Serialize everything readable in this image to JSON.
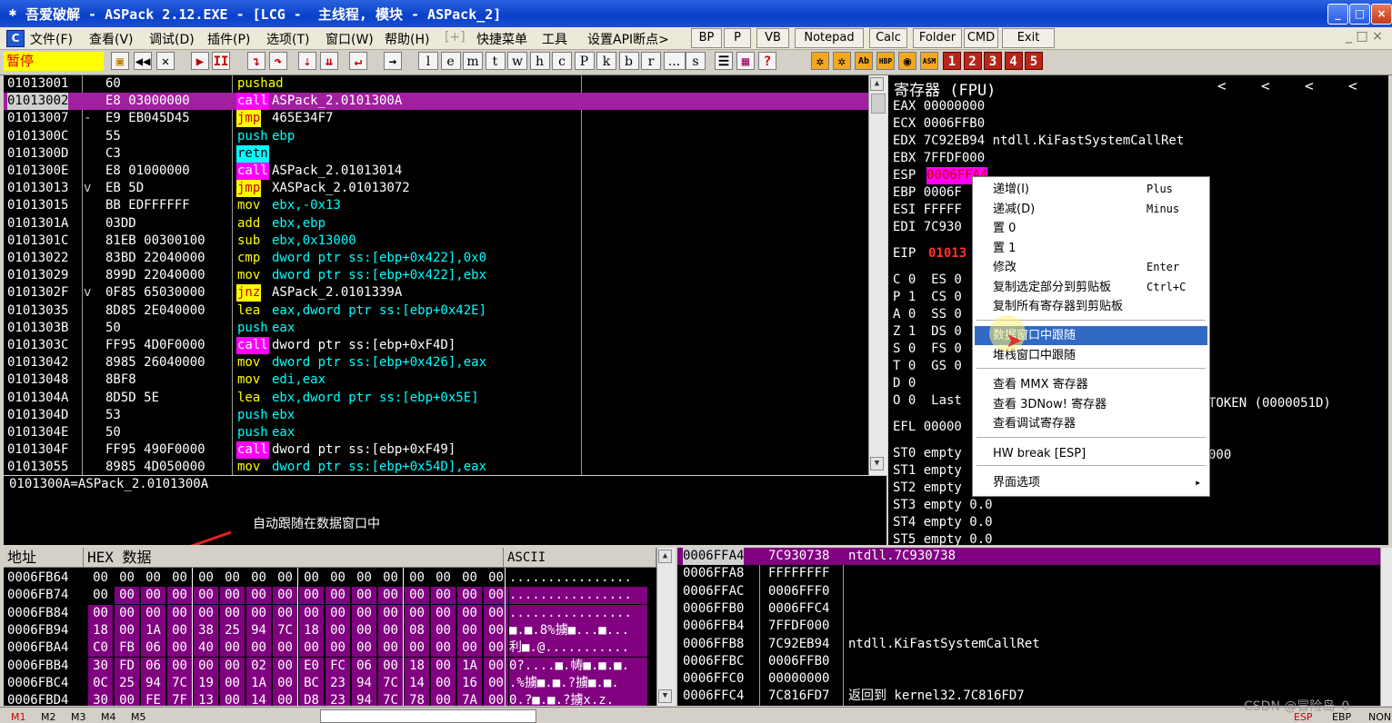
{
  "window": {
    "title": "吾爱破解 - ASPack 2.12.EXE - [LCG -  主线程, 模块 - ASPack_2]",
    "min": "_",
    "max": "□",
    "close": "×"
  },
  "menu": {
    "items": [
      "文件(F)",
      "查看(V)",
      "调试(D)",
      "插件(P)",
      "选项(T)",
      "窗口(W)",
      "帮助(H)",
      "[+]",
      "快捷菜单",
      "工具",
      "设置API断点>"
    ],
    "buttons": [
      "BP",
      "P",
      "VB",
      "Notepad",
      "Calc",
      "Folder",
      "CMD",
      "Exit"
    ]
  },
  "toolbar": {
    "status": "暂停",
    "letters": [
      "l",
      "e",
      "m",
      "t",
      "w",
      "h",
      "c",
      "P",
      "k",
      "b",
      "r",
      "...",
      "s"
    ],
    "nums": [
      "1",
      "2",
      "3",
      "4",
      "5"
    ]
  },
  "disasm": {
    "rows": [
      {
        "addr": "01013001",
        "mark": "",
        "hex": "60",
        "op": "pushad",
        "args": ""
      },
      {
        "addr": "01013002",
        "mark": "",
        "hex": "E8 03000000",
        "op": "call",
        "args": "ASPack_2.0101300A"
      },
      {
        "addr": "01013007",
        "mark": "-",
        "hex": "E9 EB045D45",
        "op": "jmp",
        "args": "465E34F7"
      },
      {
        "addr": "0101300C",
        "mark": "",
        "hex": "55",
        "op": "push",
        "args": "ebp"
      },
      {
        "addr": "0101300D",
        "mark": "",
        "hex": "C3",
        "op": "retn",
        "args": ""
      },
      {
        "addr": "0101300E",
        "mark": "",
        "hex": "E8 01000000",
        "op": "call",
        "args": "ASPack_2.01013014"
      },
      {
        "addr": "01013013",
        "mark": "v",
        "hex": "EB 5D",
        "op": "jmp",
        "args": "XASPack_2.01013072"
      },
      {
        "addr": "01013015",
        "mark": "",
        "hex": "BB EDFFFFFF",
        "op": "mov",
        "args": "ebx,-0x13"
      },
      {
        "addr": "0101301A",
        "mark": "",
        "hex": "03DD",
        "op": "add",
        "args": "ebx,ebp"
      },
      {
        "addr": "0101301C",
        "mark": "",
        "hex": "81EB 00300100",
        "op": "sub",
        "args": "ebx,0x13000"
      },
      {
        "addr": "01013022",
        "mark": "",
        "hex": "83BD 22040000",
        "op": "cmp",
        "args": "dword ptr ss:[ebp+0x422],0x0"
      },
      {
        "addr": "01013029",
        "mark": "",
        "hex": "899D 22040000",
        "op": "mov",
        "args": "dword ptr ss:[ebp+0x422],ebx"
      },
      {
        "addr": "0101302F",
        "mark": "v",
        "hex": "0F85 65030000",
        "op": "jnz",
        "args": "ASPack_2.0101339A"
      },
      {
        "addr": "01013035",
        "mark": "",
        "hex": "8D85 2E040000",
        "op": "lea",
        "args": "eax,dword ptr ss:[ebp+0x42E]"
      },
      {
        "addr": "0101303B",
        "mark": "",
        "hex": "50",
        "op": "push",
        "args": "eax"
      },
      {
        "addr": "0101303C",
        "mark": "",
        "hex": "FF95 4D0F0000",
        "op": "call",
        "args": "dword ptr ss:[ebp+0xF4D]"
      },
      {
        "addr": "01013042",
        "mark": "",
        "hex": "8985 26040000",
        "op": "mov",
        "args": "dword ptr ss:[ebp+0x426],eax"
      },
      {
        "addr": "01013048",
        "mark": "",
        "hex": "8BF8",
        "op": "mov",
        "args": "edi,eax"
      },
      {
        "addr": "0101304A",
        "mark": "",
        "hex": "8D5D 5E",
        "op": "lea",
        "args": "ebx,dword ptr ss:[ebp+0x5E]"
      },
      {
        "addr": "0101304D",
        "mark": "",
        "hex": "53",
        "op": "push",
        "args": "ebx"
      },
      {
        "addr": "0101304E",
        "mark": "",
        "hex": "50",
        "op": "push",
        "args": "eax"
      },
      {
        "addr": "0101304F",
        "mark": "",
        "hex": "FF95 490F0000",
        "op": "call",
        "args": "dword ptr ss:[ebp+0xF49]"
      },
      {
        "addr": "01013055",
        "mark": "",
        "hex": "8985 4D050000",
        "op": "mov",
        "args": "dword ptr ss:[ebp+0x54D],eax"
      }
    ],
    "info": "0101300A=ASPack_2.0101300A",
    "annotation": "自动跟随在数据窗口中"
  },
  "registers": {
    "title": "寄存器 (FPU)",
    "nav": [
      "<",
      "<",
      "<",
      "<"
    ],
    "lines": [
      {
        "t": "EAX 00000000",
        "c": "#fff"
      },
      {
        "t": "ECX 0006FFB0",
        "c": "#fff"
      },
      {
        "t": "EDX 7C92EB94 ntdll.KiFastSystemCallRet",
        "c": "#fff"
      },
      {
        "t": "EBX 7FFDF000",
        "c": "#fff"
      },
      {
        "t": "ESP",
        "c": "#fff"
      },
      {
        "t": "EBP 0006F",
        "c": "#fff"
      },
      {
        "t": "ESI FFFFF",
        "c": "#fff"
      },
      {
        "t": "EDI 7C930",
        "c": "#fff"
      },
      {
        "t": "",
        "c": "#fff"
      },
      {
        "t": "EIP",
        "c": "#fff"
      },
      {
        "t": "",
        "c": "#fff"
      },
      {
        "t": "C 0  ES 0",
        "c": "#fff"
      },
      {
        "t": "P 1  CS 0",
        "c": "#fff"
      },
      {
        "t": "A 0  SS 0",
        "c": "#fff"
      },
      {
        "t": "Z 1  DS 0",
        "c": "#fff"
      },
      {
        "t": "S 0  FS 0",
        "c": "#fff"
      },
      {
        "t": "T 0  GS 0",
        "c": "#fff"
      },
      {
        "t": "D 0",
        "c": "#fff"
      },
      {
        "t": "O 0  Last",
        "c": "#fff"
      },
      {
        "t": "",
        "c": "#fff"
      },
      {
        "t": "EFL 00000",
        "c": "#fff"
      },
      {
        "t": "",
        "c": "#fff"
      },
      {
        "t": "ST0 empty",
        "c": "#fff"
      },
      {
        "t": "ST1 empty",
        "c": "#fff"
      },
      {
        "t": "ST2 empty",
        "c": "#fff"
      },
      {
        "t": "ST3 empty 0.0",
        "c": "#fff"
      },
      {
        "t": "ST4 empty 0.0",
        "c": "#fff"
      },
      {
        "t": "ST5 empty 0.0",
        "c": "#fff"
      }
    ],
    "esp_val": "0006FFA4",
    "eip_val": "01013",
    "token": "TOKEN (0000051D)",
    "st1_tail": "000"
  },
  "context_menu": {
    "items": [
      {
        "label": "递增(I)",
        "key": "Plus"
      },
      {
        "label": "递减(D)",
        "key": "Minus"
      },
      {
        "label": "置 0",
        "key": ""
      },
      {
        "label": "置 1",
        "key": ""
      },
      {
        "label": "修改",
        "key": "Enter"
      },
      {
        "label": "复制选定部分到剪贴板",
        "key": "Ctrl+C"
      },
      {
        "label": "复制所有寄存器到剪贴板",
        "key": ""
      },
      {
        "label": "数据窗口中跟随",
        "key": ""
      },
      {
        "label": "堆栈窗口中跟随",
        "key": ""
      },
      {
        "label": "查看 MMX 寄存器",
        "key": ""
      },
      {
        "label": "查看 3DNow! 寄存器",
        "key": ""
      },
      {
        "label": "查看调试寄存器",
        "key": ""
      },
      {
        "label": "HW break [ESP]",
        "key": ""
      },
      {
        "label": "界面选项",
        "key": "▸"
      }
    ]
  },
  "dump": {
    "headers": [
      "地址",
      "HEX 数据",
      "ASCII"
    ],
    "rows": [
      {
        "addr": "0006FB64",
        "hex": "00 00 00 00 00 00 00 00 00 00 00 00 00 00 00 00",
        "ascii": "................"
      },
      {
        "addr": "0006FB74",
        "hex": "00 00 00 00 00 00 00 00 00 00 00 00 00 00 00 00",
        "ascii": "................"
      },
      {
        "addr": "0006FB84",
        "hex": "00 00 00 00 00 00 00 00 00 00 00 00 00 00 00 00",
        "ascii": "................"
      },
      {
        "addr": "0006FB94",
        "hex": "18 00 1A 00 38 25 94 7C 18 00 00 00 08 00 00 00",
        "ascii": "■.■.8%擄■...■..."
      },
      {
        "addr": "0006FBA4",
        "hex": "C0 FB 06 00 40 00 00 00 00 00 00 00 00 00 00 00",
        "ascii": "利■.@..........."
      },
      {
        "addr": "0006FBB4",
        "hex": "30 FD 06 00 00 00 02 00 E0 FC 06 00 18 00 1A 00",
        "ascii": "0?....■.帱■.■.■."
      },
      {
        "addr": "0006FBC4",
        "hex": "0C 25 94 7C 19 00 1A 00 BC 23 94 7C 14 00 16 00",
        "ascii": ".%擄■.■.?擄■.■."
      },
      {
        "addr": "0006FBD4",
        "hex": "30 00 FE 7F 13 00 14 00 D8 23 94 7C 78 00 7A 00",
        "ascii": "0.?■.■.?擄x.z."
      }
    ]
  },
  "stack": {
    "rows": [
      {
        "addr": "0006FFA4",
        "val": "7C930738",
        "cmt": "ntdll.7C930738"
      },
      {
        "addr": "0006FFA8",
        "val": "FFFFFFFF",
        "cmt": ""
      },
      {
        "addr": "0006FFAC",
        "val": "0006FFF0",
        "cmt": ""
      },
      {
        "addr": "0006FFB0",
        "val": "0006FFC4",
        "cmt": ""
      },
      {
        "addr": "0006FFB4",
        "val": "7FFDF000",
        "cmt": ""
      },
      {
        "addr": "0006FFB8",
        "val": "7C92EB94",
        "cmt": "ntdll.KiFastSystemCallRet"
      },
      {
        "addr": "0006FFBC",
        "val": "0006FFB0",
        "cmt": ""
      },
      {
        "addr": "0006FFC0",
        "val": "00000000",
        "cmt": ""
      },
      {
        "addr": "0006FFC4",
        "val": "7C816FD7",
        "cmt": "返回到 kernel32.7C816FD7"
      }
    ]
  },
  "bottom": {
    "tabs": [
      "M1",
      "M2",
      "M3",
      "M4",
      "M5"
    ],
    "watermark": "CSDN @冒险岛_0",
    "right": [
      "ESP",
      "EBP",
      "NONE"
    ]
  },
  "colors": {
    "magenta": "#800080",
    "selrow": "#a020a0",
    "cyan": "#00ffff",
    "blue": "#316ac5"
  }
}
